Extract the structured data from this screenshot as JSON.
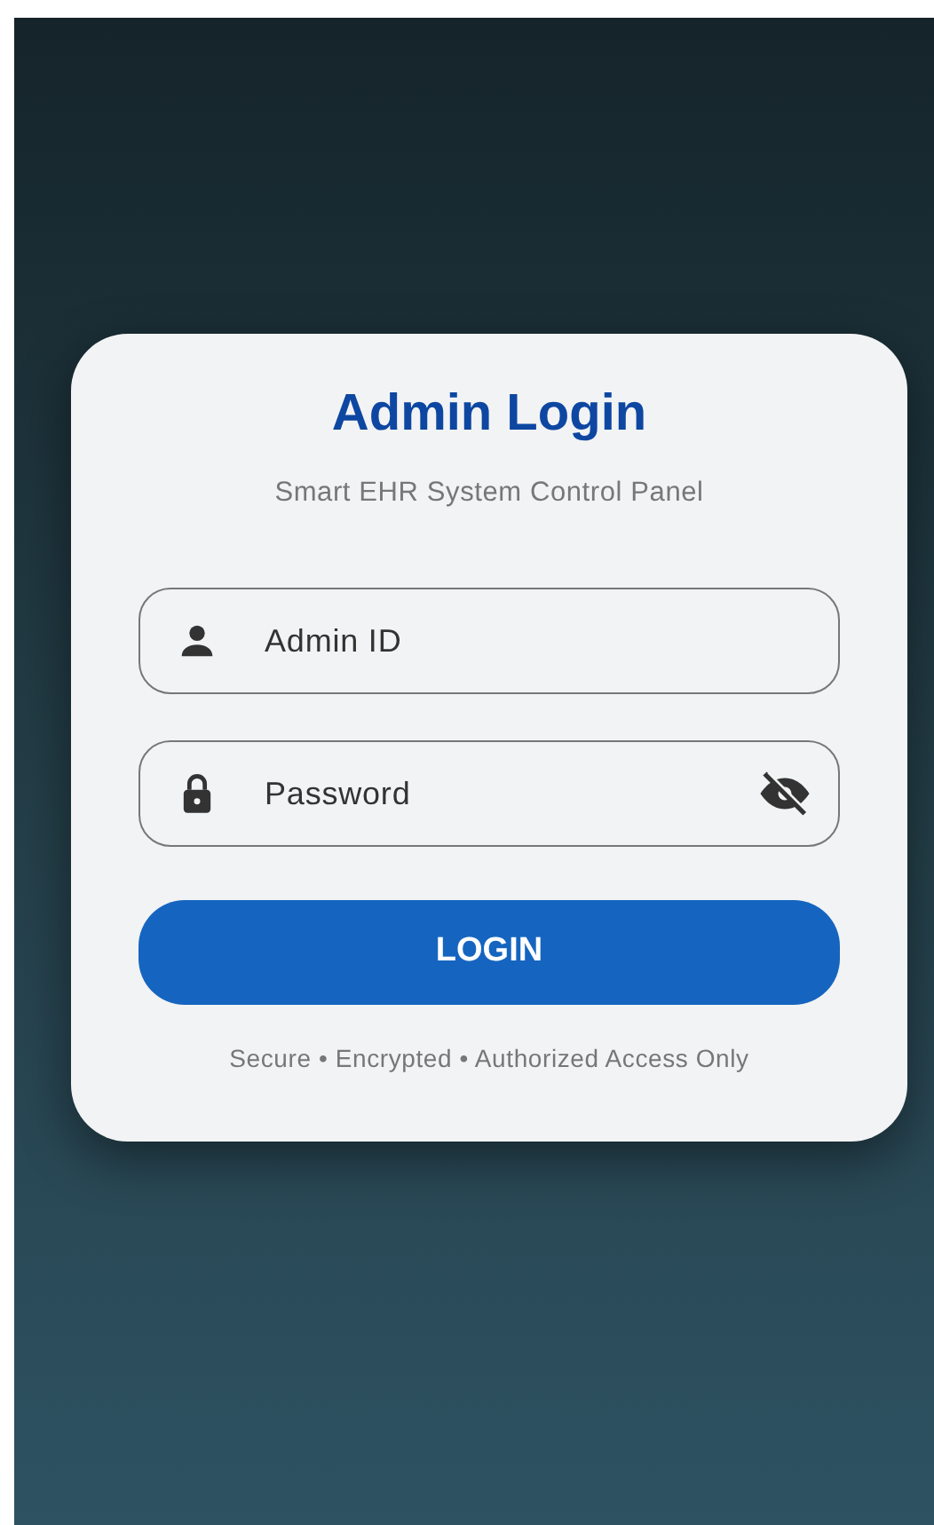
{
  "title": "Admin Login",
  "subtitle": "Smart EHR System Control Panel",
  "fields": [
    {
      "kind": "user",
      "placeholder": "Admin ID"
    },
    {
      "kind": "password",
      "placeholder": "Password",
      "password_visible": false
    }
  ],
  "button": "LOGIN",
  "footer": "Secure • Encrypted • Authorized Access Only"
}
